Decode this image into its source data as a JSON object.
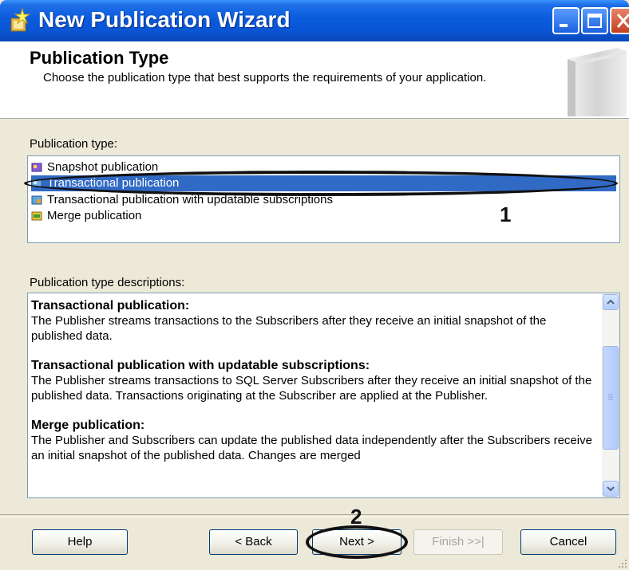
{
  "window": {
    "title": "New Publication Wizard",
    "controls": [
      "minimize",
      "maximize",
      "close"
    ]
  },
  "header": {
    "title": "Publication Type",
    "subtitle": "Choose the publication type that best supports the requirements of your application."
  },
  "publication_type": {
    "label": "Publication type:",
    "items": [
      {
        "label": "Snapshot publication",
        "icon": "snapshot-publication-icon",
        "selected": false
      },
      {
        "label": "Transactional publication",
        "icon": "transactional-publication-icon",
        "selected": true
      },
      {
        "label": "Transactional publication with updatable subscriptions",
        "icon": "updatable-publication-icon",
        "selected": false
      },
      {
        "label": "Merge publication",
        "icon": "merge-publication-icon",
        "selected": false
      }
    ]
  },
  "descriptions": {
    "label": "Publication type descriptions:",
    "items": [
      {
        "title": "Transactional publication:",
        "text": "The Publisher streams transactions to the Subscribers after they receive an initial snapshot of the published data."
      },
      {
        "title": "Transactional publication with updatable subscriptions:",
        "text": "The Publisher streams transactions to SQL Server Subscribers after they receive an initial snapshot of the published data. Transactions originating at the Subscriber are applied at the Publisher."
      },
      {
        "title": "Merge publication:",
        "text": "The Publisher and Subscribers can update the published data independently after the Subscribers receive an initial snapshot of the published data. Changes are merged"
      }
    ]
  },
  "annotations": {
    "marker_1": "1",
    "marker_2": "2"
  },
  "buttons": {
    "help": "Help",
    "back": "< Back",
    "next": "Next >",
    "finish": "Finish >>|",
    "cancel": "Cancel"
  },
  "colors": {
    "titlebar": "#0a55d4",
    "selection": "#316ac5",
    "dialog_bg": "#ece9d8"
  }
}
